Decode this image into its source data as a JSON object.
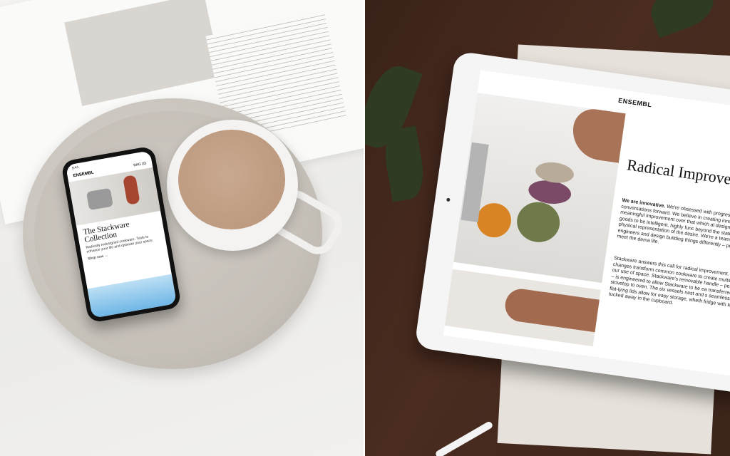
{
  "phone": {
    "status_time": "9:41",
    "brand": "ENSEMBL",
    "bag_label": "BAG (0)",
    "title": "The Stackware Collection",
    "body": "Radically redesigned cookware. Tools to enhance your life and optimize your space.",
    "cta": "Shop now"
  },
  "tablet": {
    "brand": "ENSEMBL",
    "title": "Radical Improvement",
    "lead_bold": "We are innovative.",
    "lead_text": "We're obsessed with progress and conversations forward. We believe in creating innovati represent a meaningful improvement over that which al design and engineer goods to be intelligent, highly func beyond the status quo – a physical representation of the desire. We're a team of innovators, engineers and design building things differently – products that meet the dema life.",
    "body": "Stackware answers this call for radical improvement. Simpl changes transform common cookware to create multifunc optimize our use of space. Stackware's removable handle – pending system – is engineered to allow Stackware to be ea transferred from stovetop to oven. The six vessels nest and s seamlessly and our flat-lying lids allow for easy storage, wheth fridge with leftovers or tucked away in the cupboard."
  }
}
